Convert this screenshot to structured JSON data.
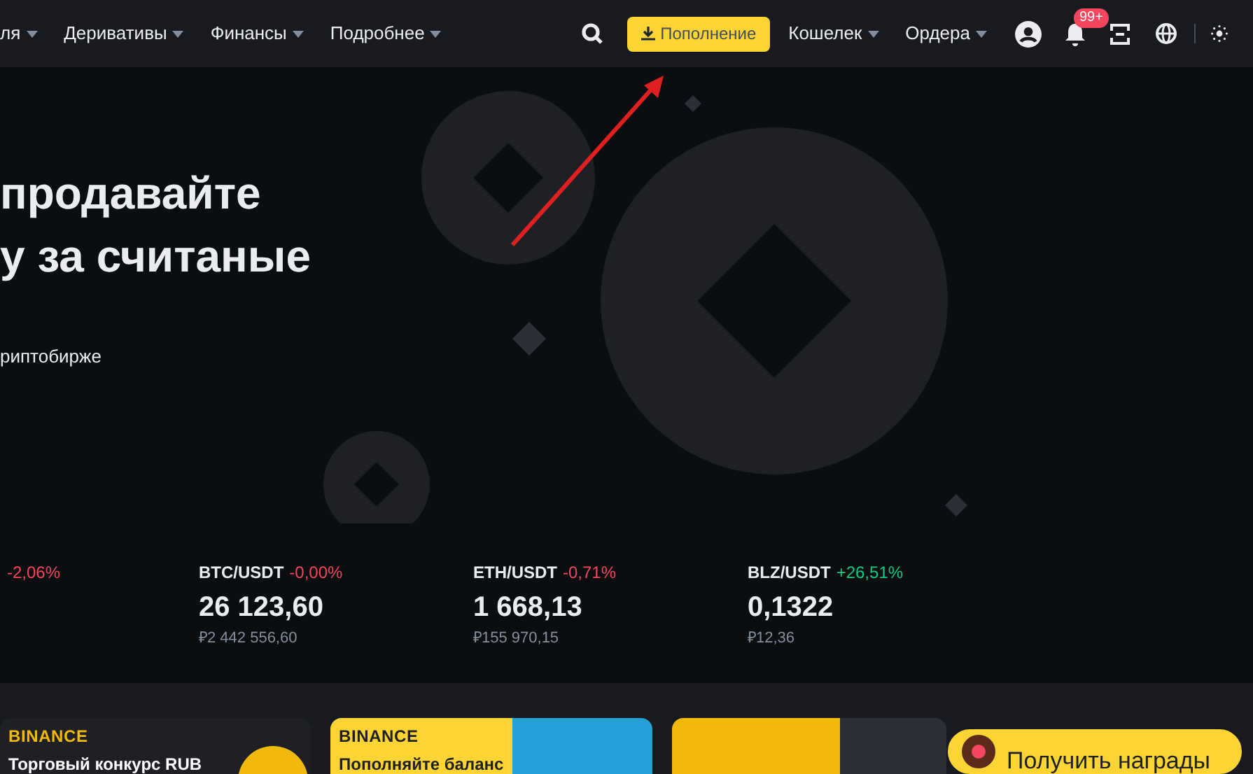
{
  "nav": {
    "items": [
      {
        "label": "ля"
      },
      {
        "label": "Деривативы"
      },
      {
        "label": "Финансы"
      },
      {
        "label": "Подробнее"
      }
    ],
    "deposit_button": "Пополнение",
    "right_items": [
      {
        "label": "Кошелек"
      },
      {
        "label": "Ордера"
      }
    ],
    "notification_badge": "99+"
  },
  "hero": {
    "heading_lines": [
      "продавайте",
      "у за считаные"
    ],
    "subtitle": "риптобирже"
  },
  "tickers": [
    {
      "change": "-2,06%",
      "color": "#f6465d"
    },
    {
      "pair": "BTC/USDT",
      "change": "-0,00%",
      "color": "#f6465d",
      "price": "26 123,60",
      "fiat": "₽2 442 556,60"
    },
    {
      "pair": "ETH/USDT",
      "change": "-0,71%",
      "color": "#f6465d",
      "price": "1 668,13",
      "fiat": "₽155 970,15"
    },
    {
      "pair": "BLZ/USDT",
      "change": "+26,51%",
      "color": "#0ecb81",
      "price": "0,1322",
      "fiat": "₽12,36"
    }
  ],
  "banners": [
    {
      "kind": "dark",
      "brand": "BINANCE",
      "title": "Торговый конкурс RUB"
    },
    {
      "kind": "blue",
      "brand": "BINANCE",
      "title": "Пополняйте баланс"
    },
    {
      "kind": "yellow"
    }
  ],
  "rewards_button": "Получить награды"
}
